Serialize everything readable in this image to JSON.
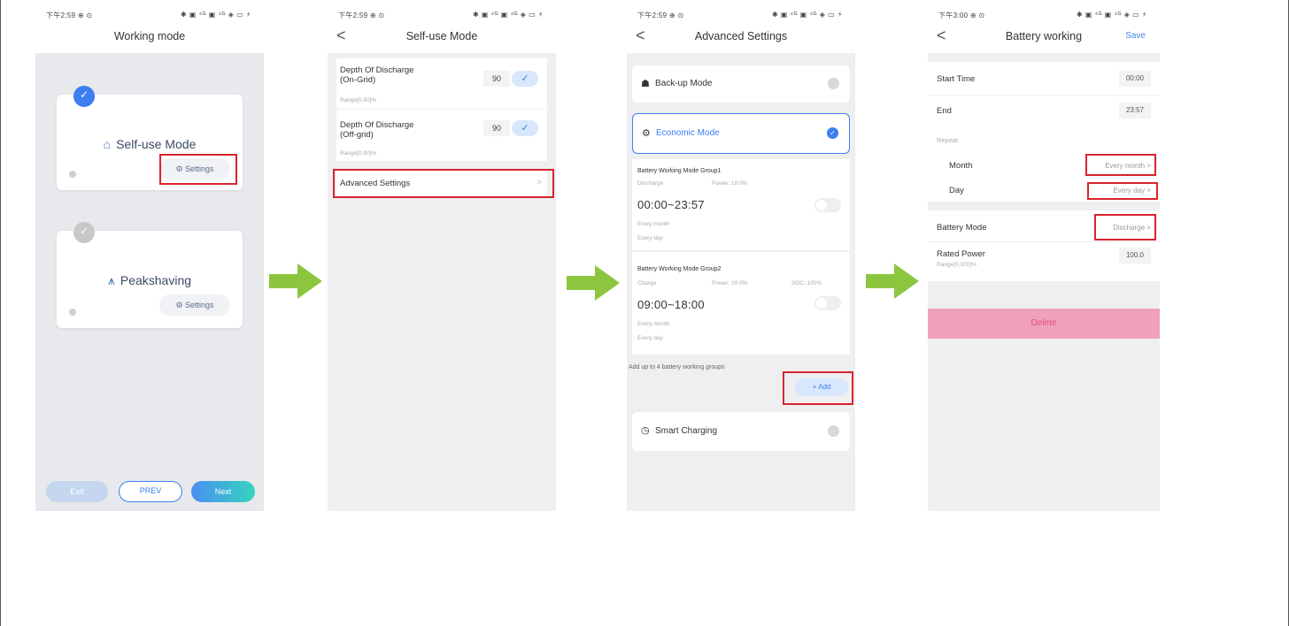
{
  "status_bar": {
    "p1": {
      "time": "下午2:59 ⊕ ⊙",
      "icons": "✱ ▣ ⁴ᴳ ▣ ⁴ᴳ ◈ ▭ ⚡"
    },
    "p2": {
      "time": "下午2:59 ⊕ ⊙",
      "icons": "✱ ▣ ⁴ᴳ ▣ ⁴ᴳ ◈ ▭ ⚡"
    },
    "p3": {
      "time": "下午2:59 ⊕ ⊙",
      "icons": "✱ ▣ ⁴ᴳ ▣ ⁴ᴳ ◈ ▭ ⚡"
    },
    "p4": {
      "time": "下午3:00 ⊕ ⊙",
      "icons": "✱ ▣ ⁴ᴳ ▣ ⁴ᴳ ◈ ▭ ⚡"
    }
  },
  "screen1": {
    "title": "Working mode",
    "mode1": {
      "name": "Self-use Mode",
      "settings": "Settings"
    },
    "mode2": {
      "name": "Peakshaving",
      "settings": "Settings"
    },
    "exit": "Exit",
    "prev": "PREV",
    "next": "Next"
  },
  "screen2": {
    "back": "<",
    "title": "Self-use Mode",
    "dod_on": {
      "label1": "Depth Of Discharge",
      "label2": "(On-Grid)",
      "range": "Range[0,90]%",
      "value": "90"
    },
    "dod_off": {
      "label1": "Depth Of Discharge",
      "label2": "(Off-grid)",
      "range": "Range[0,90]%",
      "value": "90"
    },
    "advanced": "Advanced Settings",
    "chevron": ">"
  },
  "screen3": {
    "back": "<",
    "title": "Advanced Settings",
    "backup": "Back-up Mode",
    "economic": "Economic Mode",
    "group1": {
      "title": "Battery Working Mode Group1",
      "mode": "Discharge",
      "power": "Power: 10.0%",
      "time": "00:00~23:57",
      "month": "Every month",
      "day": "Every day"
    },
    "group2": {
      "title": "Battery Working Mode Group2",
      "mode": "Charge",
      "power": "Power: 20.0%",
      "soc": "SOC: 100%",
      "time": "09:00~18:00",
      "month": "Every month",
      "day": "Every day"
    },
    "note": "Add up to 4 battery working groups",
    "add": "+ Add",
    "smart": "Smart Charging"
  },
  "screen4": {
    "back": "<",
    "title": "Battery working",
    "save": "Save",
    "start_label": "Start Time",
    "start_value": "00:00",
    "end_label": "End",
    "end_value": "23:57",
    "repeat": "Repeat",
    "month_label": "Month",
    "month_value": "Every month >",
    "day_label": "Day",
    "day_value": "Every day >",
    "mode_label": "Battery Mode",
    "mode_value": "Discharge >",
    "power_label": "Rated Power",
    "power_range": "Range[0,100]%",
    "power_value": "100.0",
    "delete": "Delete"
  },
  "colors": {
    "accent_blue": "#3d7ef2",
    "highlight_red": "#d9232d",
    "arrow_green": "#8cc63f",
    "delete_pink": "#f0a0bc",
    "delete_text": "#e0507e"
  },
  "icons": {
    "arrow": "right-arrow-icon",
    "check": "check-icon",
    "gear": "gear-icon",
    "info": "info-icon",
    "house": "house-icon",
    "peak": "peakshaving-icon",
    "clock": "clock-icon"
  }
}
